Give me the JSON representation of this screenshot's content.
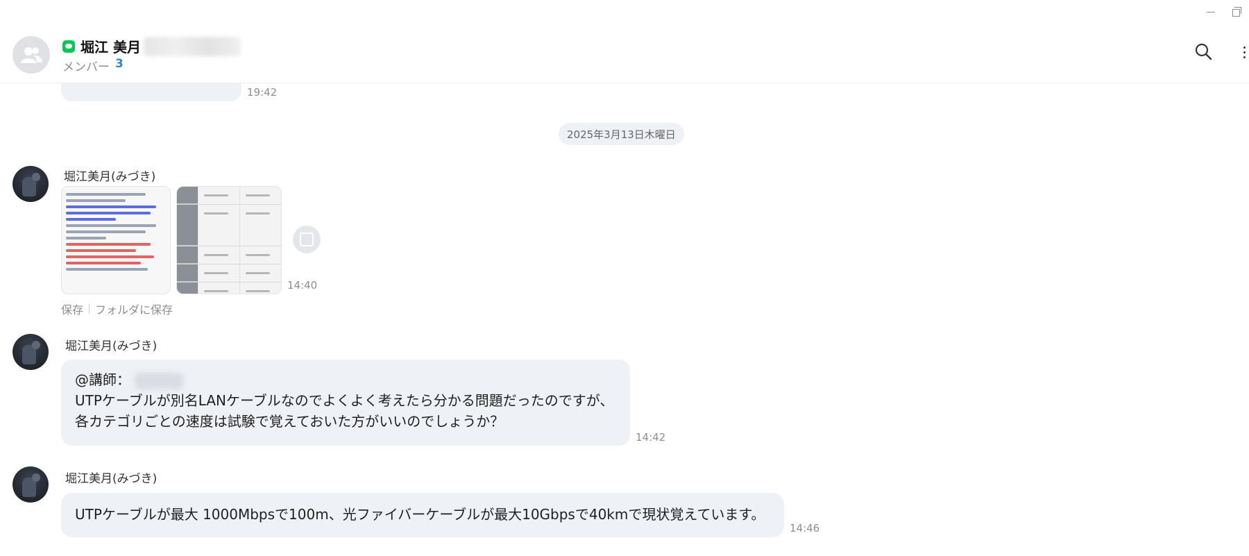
{
  "window": {
    "minimize_icon": "minimize-icon",
    "restore_icon": "restore-icon"
  },
  "header": {
    "title": "堀江 美月",
    "members_label": "メンバー",
    "members_count": "3",
    "icons": [
      "group-avatar-icon",
      "line-badge-icon",
      "search-icon",
      "more-icon"
    ]
  },
  "messages": {
    "prev_time": "19:42",
    "date_separator": "2025年3月13日木曜日",
    "image_message": {
      "sender": "堀江美月(みづき)",
      "time": "14:40",
      "save_label": "保存",
      "save_folder_label": "フォルダに保存"
    },
    "message_2": {
      "sender": "堀江美月(みづき)",
      "mention": "@講師：",
      "line1": "UTPケーブルが別名LANケーブルなのでよくよく考えたら分かる問題だったのですが、",
      "line2": "各カテゴリごとの速度は試験で覚えておいた方がいいのでしょうか？",
      "time": "14:42"
    },
    "message_3": {
      "sender": "堀江美月(みづき)",
      "text": "UTPケーブルが最大 1000Mbpsで100m、光ファイバーケーブルが最大10Gbpsで40kmで現状覚えています。",
      "time": "14:46"
    }
  },
  "colors": {
    "bubble": "#eef1f5",
    "accent": "#2f86d8",
    "line_green": "#06c755"
  }
}
